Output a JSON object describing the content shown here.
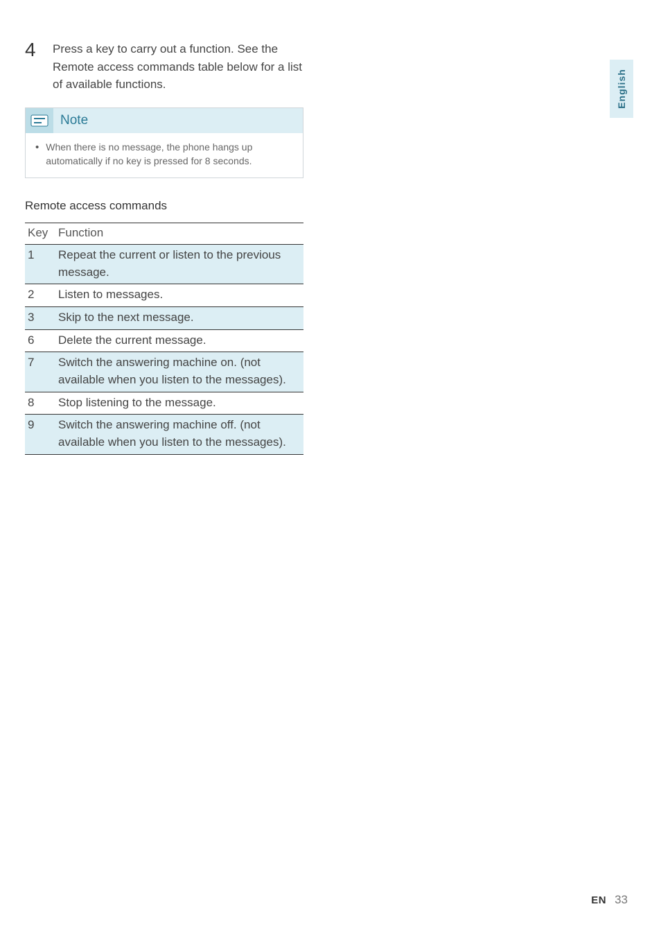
{
  "step": {
    "number": "4",
    "text": "Press a key to carry out a function. See the Remote access commands table below for a list of available functions."
  },
  "note": {
    "label": "Note",
    "bullet": "When there is no message, the phone hangs up automatically if no key is pressed for 8 seconds."
  },
  "table": {
    "title": "Remote access commands",
    "header_key": "Key",
    "header_function": "Function",
    "rows": [
      {
        "key": "1",
        "function": "Repeat the current or listen to the previous message.",
        "shaded": true
      },
      {
        "key": "2",
        "function": "Listen to messages.",
        "shaded": false
      },
      {
        "key": "3",
        "function": "Skip to the next message.",
        "shaded": true
      },
      {
        "key": "6",
        "function": "Delete the current message.",
        "shaded": false
      },
      {
        "key": "7",
        "function": "Switch the answering machine on. (not available when you listen to the messages).",
        "shaded": true
      },
      {
        "key": "8",
        "function": "Stop listening to the message.",
        "shaded": false
      },
      {
        "key": "9",
        "function": "Switch the answering machine off. (not available when you listen to the messages).",
        "shaded": true
      }
    ]
  },
  "side_tab": "English",
  "footer": {
    "lang": "EN",
    "page": "33"
  }
}
